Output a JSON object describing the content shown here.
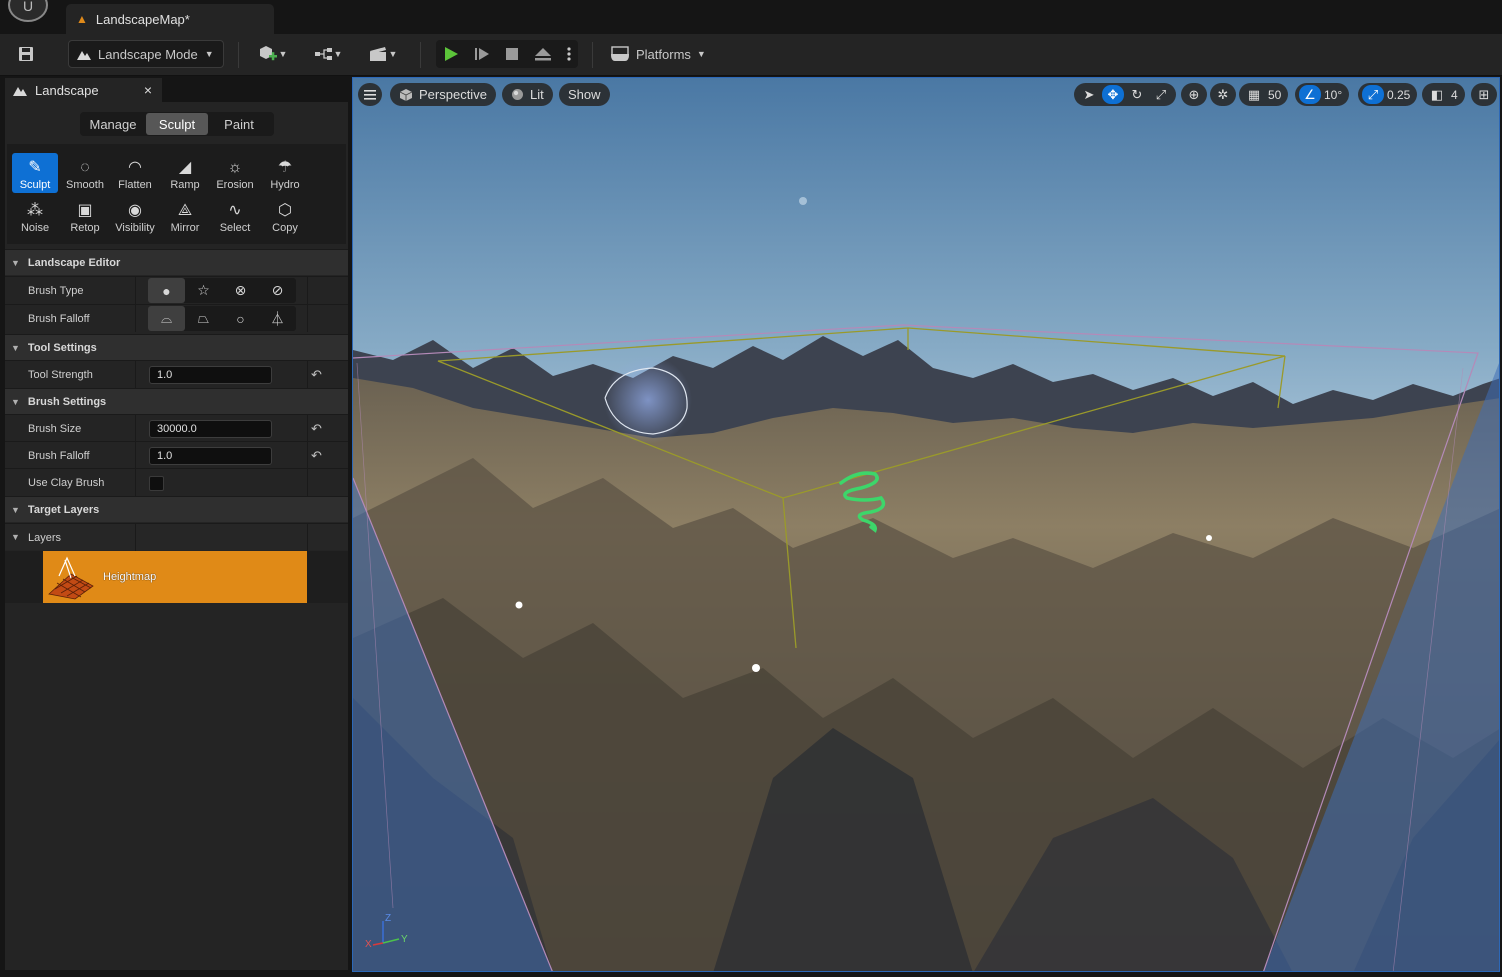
{
  "window": {
    "tab_title": "LandscapeMap*"
  },
  "toolbar": {
    "mode_label": "Landscape Mode",
    "platforms_label": "Platforms",
    "icons": [
      "save-icon",
      "add-actor-icon",
      "blueprint-icon",
      "cinematics-icon",
      "play-icon",
      "skip-frame-icon",
      "stop-icon",
      "eject-icon",
      "more-options-icon",
      "platforms-icon"
    ]
  },
  "panel": {
    "tab_title": "Landscape",
    "close": "×",
    "mode_tabs": [
      {
        "label": "Manage",
        "active": false
      },
      {
        "label": "Sculpt",
        "active": true
      },
      {
        "label": "Paint",
        "active": false
      }
    ],
    "tools": [
      {
        "label": "Sculpt",
        "icon": "sculpt-brush-icon",
        "active": true
      },
      {
        "label": "Smooth",
        "icon": "smooth-icon",
        "active": false
      },
      {
        "label": "Flatten",
        "icon": "flatten-icon",
        "active": false
      },
      {
        "label": "Ramp",
        "icon": "ramp-icon",
        "active": false
      },
      {
        "label": "Erosion",
        "icon": "erosion-icon",
        "active": false
      },
      {
        "label": "Hydro",
        "icon": "hydro-erosion-icon",
        "active": false
      },
      {
        "label": "Noise",
        "icon": "noise-icon",
        "active": false
      },
      {
        "label": "Retop",
        "icon": "retopologize-icon",
        "active": false
      },
      {
        "label": "Visibility",
        "icon": "visibility-icon",
        "active": false
      },
      {
        "label": "Mirror",
        "icon": "mirror-icon",
        "active": false
      },
      {
        "label": "Select",
        "icon": "select-icon",
        "active": false
      },
      {
        "label": "Copy",
        "icon": "copy-icon",
        "active": false
      }
    ],
    "landscape_editor": {
      "title": "Landscape Editor",
      "brush_type_label": "Brush Type",
      "brush_falloff_label": "Brush Falloff"
    },
    "tool_settings": {
      "title": "Tool Settings",
      "tool_strength_label": "Tool Strength",
      "tool_strength_value": "1.0"
    },
    "brush_settings": {
      "title": "Brush Settings",
      "brush_size_label": "Brush Size",
      "brush_size_value": "30000.0",
      "brush_falloff_label": "Brush Falloff",
      "brush_falloff_value": "1.0",
      "use_clay_label": "Use Clay Brush",
      "use_clay_checked": false
    },
    "target_layers": {
      "title": "Target Layers",
      "layers_label": "Layers",
      "layer_name": "Heightmap"
    }
  },
  "viewport": {
    "perspective_label": "Perspective",
    "lit_label": "Lit",
    "show_label": "Show",
    "grid_snap": "50",
    "rotation_snap": "10°",
    "scale_snap": "0.25",
    "camera_speed": "4",
    "axis": {
      "x": "X",
      "y": "Y",
      "z": "Z"
    },
    "colors": {
      "accent": "#0e70d4",
      "selected_layer": "#e08a17",
      "sky_top": "#4f7da8",
      "sky_horizon": "#a9c6d9"
    }
  }
}
